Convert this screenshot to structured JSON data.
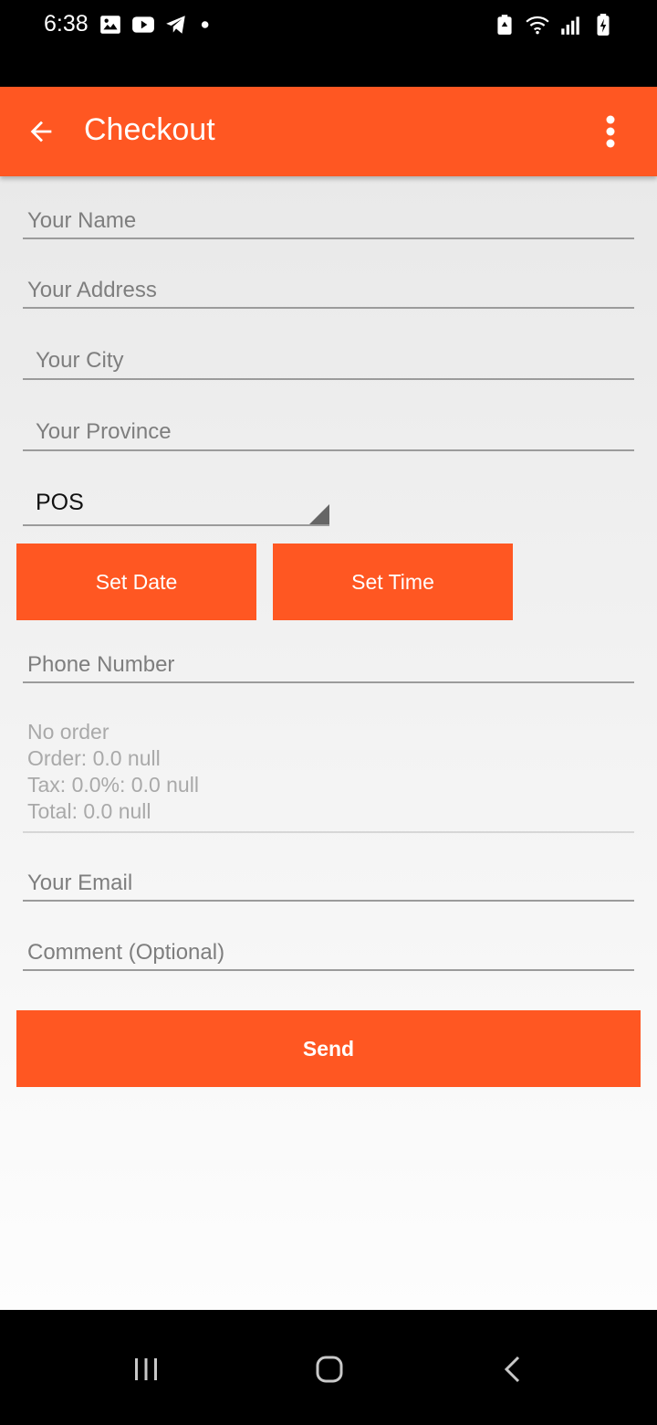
{
  "status_bar": {
    "time": "6:38",
    "left_icons": [
      "gallery-icon",
      "youtube-icon",
      "telegram-icon",
      "dot-icon"
    ],
    "right_icons": [
      "battery-saver-icon",
      "wifi-icon",
      "signal-icon",
      "battery-charging-icon"
    ]
  },
  "app_bar": {
    "title": "Checkout",
    "back_icon": "arrow-back-icon",
    "menu_icon": "more-vert-icon",
    "background": "#ff5722"
  },
  "form": {
    "name_placeholder": "Your Name",
    "address_placeholder": "Your Address",
    "city_placeholder": "Your City",
    "province_placeholder": "Your Province",
    "payment_selected": "POS",
    "set_date_label": "Set Date",
    "set_time_label": "Set Time",
    "phone_placeholder": "Phone Number",
    "order_summary": {
      "line1": "No order",
      "line2": "Order: 0.0 null",
      "line3": "Tax: 0.0%: 0.0 null",
      "line4": "Total: 0.0 null"
    },
    "email_placeholder": "Your Email",
    "comment_placeholder": "Comment (Optional)",
    "send_label": "Send"
  },
  "nav_bar": {
    "icons": [
      "recent-apps-icon",
      "home-icon",
      "back-icon"
    ]
  }
}
